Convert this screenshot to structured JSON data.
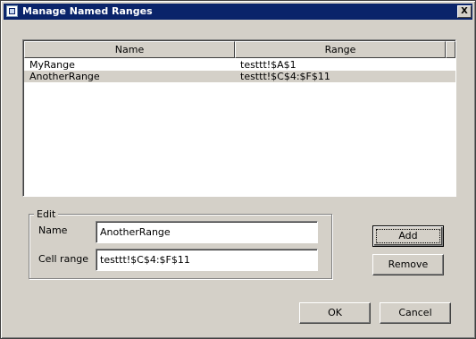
{
  "window": {
    "title": "Manage Named Ranges",
    "close_label": "X"
  },
  "table": {
    "columns": [
      "Name",
      "Range"
    ],
    "rows": [
      {
        "name": "MyRange",
        "range": "testtt!$A$1"
      },
      {
        "name": "AnotherRange",
        "range": "testtt!$C$4:$F$11"
      }
    ]
  },
  "edit": {
    "legend": "Edit",
    "name_label": "Name",
    "name_value": "AnotherRange",
    "cell_range_label": "Cell range",
    "cell_range_value": "testtt!$C$4:$F$11"
  },
  "buttons": {
    "add": "Add",
    "remove": "Remove",
    "ok": "OK",
    "cancel": "Cancel"
  }
}
